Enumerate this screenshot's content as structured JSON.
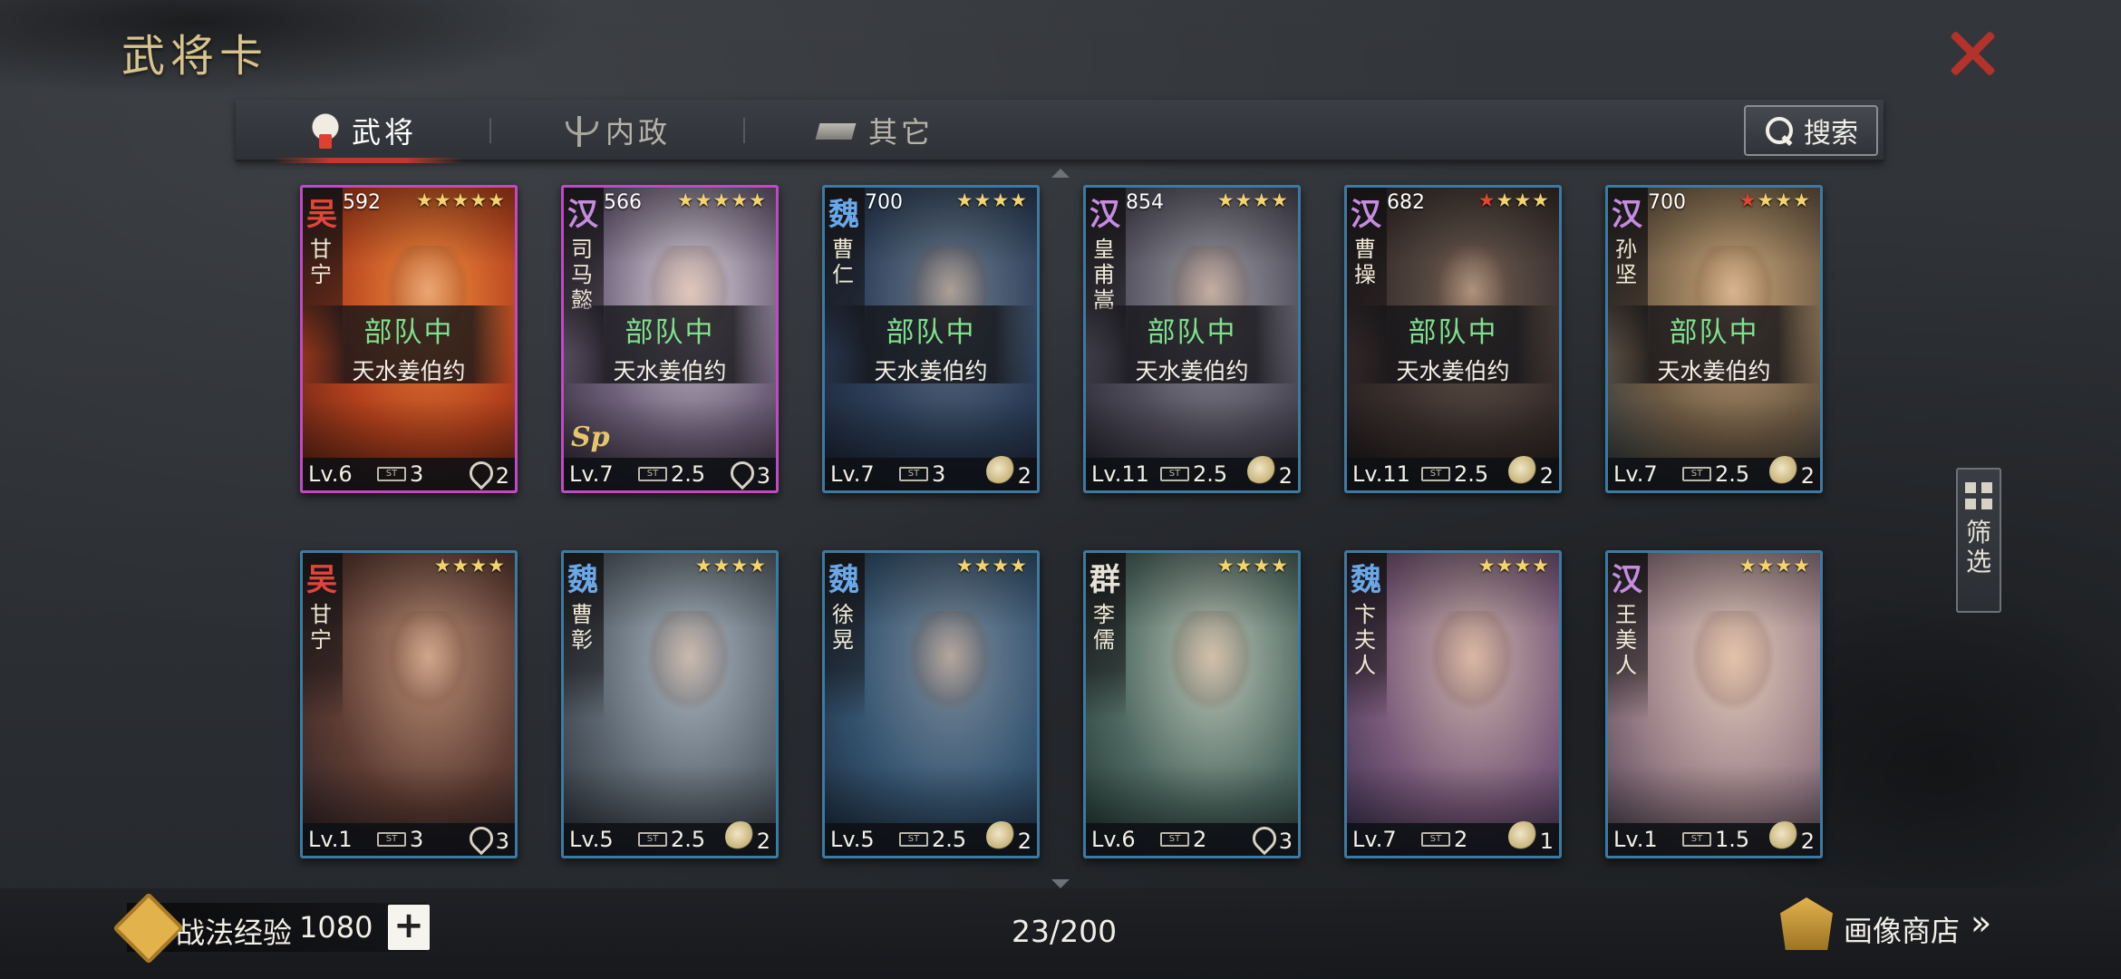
{
  "header": {
    "title": "武将卡"
  },
  "tabs": [
    {
      "label": "武将",
      "icon": "helmet-icon",
      "active": true
    },
    {
      "label": "内政",
      "icon": "scale-icon",
      "active": false
    },
    {
      "label": "其它",
      "icon": "ingot-icon",
      "active": false
    }
  ],
  "search": {
    "label": "搜索"
  },
  "filter": {
    "label": "筛选"
  },
  "deployment": {
    "status": "部队中",
    "team": "天水姜伯约"
  },
  "cards": [
    {
      "faction": "吴",
      "faction_color": "#e2453a",
      "name": "甘宁",
      "cost_top": "592",
      "stars": 5,
      "red_stars": 0,
      "deployed": true,
      "level": "Lv.6",
      "cost": "3",
      "unit": "bow",
      "unit_count": "2",
      "border": "purple",
      "sp": false,
      "art": [
        "#f08a3c",
        "#b2401d",
        "#5a2214"
      ]
    },
    {
      "faction": "汉",
      "faction_color": "#c58ce0",
      "name": "司马懿",
      "cost_top": "566",
      "stars": 5,
      "red_stars": 0,
      "deployed": true,
      "level": "Lv.7",
      "cost": "2.5",
      "unit": "bow",
      "unit_count": "3",
      "border": "purple",
      "sp": true,
      "sp_label": "Sp",
      "art": [
        "#d8d2da",
        "#6d5f78",
        "#2f2935"
      ]
    },
    {
      "faction": "魏",
      "faction_color": "#6aa8e8",
      "name": "曹仁",
      "cost_top": "700",
      "stars": 4,
      "red_stars": 0,
      "deployed": true,
      "level": "Lv.7",
      "cost": "3",
      "unit": "horse",
      "unit_count": "2",
      "border": "blue",
      "sp": false,
      "art": [
        "#6a7b8c",
        "#2c3e58",
        "#1a2233"
      ]
    },
    {
      "faction": "汉",
      "faction_color": "#c58ce0",
      "name": "皇甫嵩",
      "cost_top": "854",
      "stars": 4,
      "red_stars": 0,
      "deployed": true,
      "level": "Lv.11",
      "cost": "2.5",
      "unit": "horse",
      "unit_count": "2",
      "border": "blue",
      "sp": false,
      "art": [
        "#9a9aa2",
        "#4f4c5a",
        "#23222c"
      ]
    },
    {
      "faction": "汉",
      "faction_color": "#c58ce0",
      "name": "曹操",
      "cost_top": "682",
      "stars": 4,
      "red_stars": 1,
      "deployed": true,
      "level": "Lv.11",
      "cost": "2.5",
      "unit": "horse",
      "unit_count": "2",
      "border": "blue",
      "sp": false,
      "art": [
        "#6b5d52",
        "#3a2f2c",
        "#1e1a1c"
      ]
    },
    {
      "faction": "汉",
      "faction_color": "#c58ce0",
      "name": "孙坚",
      "cost_top": "700",
      "stars": 4,
      "red_stars": 1,
      "deployed": true,
      "level": "Lv.7",
      "cost": "2.5",
      "unit": "horse",
      "unit_count": "2",
      "border": "blue",
      "sp": false,
      "art": [
        "#c9a77a",
        "#6e5a44",
        "#2e3a40"
      ]
    },
    {
      "faction": "吴",
      "faction_color": "#e2453a",
      "name": "甘宁",
      "cost_top": "",
      "stars": 4,
      "red_stars": 0,
      "deployed": false,
      "level": "Lv.1",
      "cost": "3",
      "unit": "bow",
      "unit_count": "3",
      "border": "blue",
      "sp": false,
      "art": [
        "#b58a72",
        "#5e3c33",
        "#2a2226"
      ]
    },
    {
      "faction": "魏",
      "faction_color": "#6aa8e8",
      "name": "曹彰",
      "cost_top": "",
      "stars": 4,
      "red_stars": 0,
      "deployed": false,
      "level": "Lv.5",
      "cost": "2.5",
      "unit": "horse",
      "unit_count": "2",
      "border": "blue",
      "sp": false,
      "art": [
        "#a8b4be",
        "#5c6670",
        "#2a3038"
      ]
    },
    {
      "faction": "魏",
      "faction_color": "#6aa8e8",
      "name": "徐晃",
      "cost_top": "",
      "stars": 4,
      "red_stars": 0,
      "deployed": false,
      "level": "Lv.5",
      "cost": "2.5",
      "unit": "horse",
      "unit_count": "2",
      "border": "blue",
      "sp": false,
      "art": [
        "#7a8a9a",
        "#355470",
        "#1b2a3c"
      ]
    },
    {
      "faction": "群",
      "faction_color": "#e6e2d8",
      "name": "李儒",
      "cost_top": "",
      "stars": 4,
      "red_stars": 0,
      "deployed": false,
      "level": "Lv.6",
      "cost": "2",
      "unit": "bow",
      "unit_count": "3",
      "border": "blue",
      "sp": false,
      "art": [
        "#b9c2b6",
        "#4f6a62",
        "#223632"
      ]
    },
    {
      "faction": "魏",
      "faction_color": "#6aa8e8",
      "name": "卞夫人",
      "cost_top": "",
      "stars": 4,
      "red_stars": 0,
      "deployed": false,
      "level": "Lv.7",
      "cost": "2",
      "unit": "horse",
      "unit_count": "1",
      "border": "blue",
      "sp": false,
      "art": [
        "#c8b0a8",
        "#7a5a7a",
        "#3a3050"
      ]
    },
    {
      "faction": "汉",
      "faction_color": "#c58ce0",
      "name": "王美人",
      "cost_top": "",
      "stars": 4,
      "red_stars": 0,
      "deployed": false,
      "level": "Lv.1",
      "cost": "1.5",
      "unit": "horse",
      "unit_count": "2",
      "border": "blue",
      "sp": false,
      "art": [
        "#e0c8b8",
        "#9a7f88",
        "#4e4252"
      ]
    }
  ],
  "cost_badge": "ST",
  "footer": {
    "exp_label": "战法经验",
    "exp_value": "1080",
    "plus_label": "+",
    "page_count": "23/200",
    "shop_label": "画像商店",
    "shop_chevron": "»"
  }
}
